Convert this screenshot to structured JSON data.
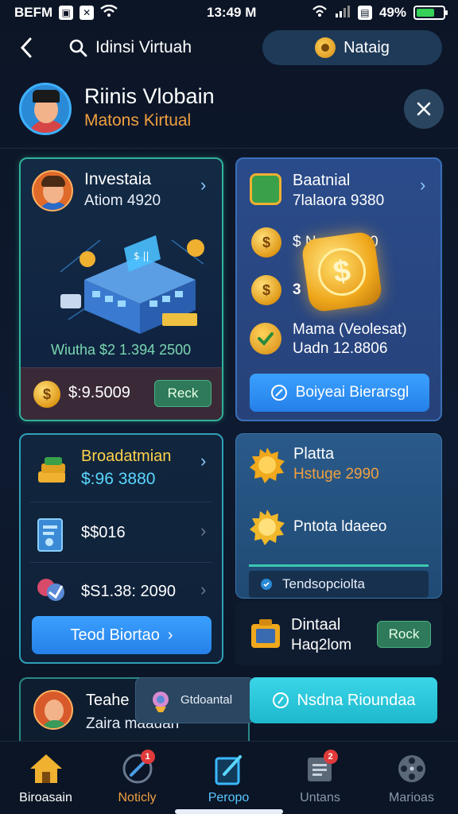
{
  "status_bar": {
    "carrier": "BEFM",
    "time": "13:49",
    "time_suffix": "M",
    "battery": "49%"
  },
  "top_nav": {
    "search_text": "Idinsi Virtuah",
    "network_label": "Nataig"
  },
  "profile": {
    "name": "Riinis Vlobain",
    "subtitle": "Matons Kirtual"
  },
  "invest_card": {
    "title": "Investaia",
    "subtitle": "Atiom 4920",
    "stats": "Wiutha $2 1.394 2500",
    "amount": "$:9.5009",
    "action": "Reck"
  },
  "balance_card": {
    "title": "Baatnial",
    "subtitle": "7lalaora 9380",
    "row1": "$ Nasa 2000",
    "row2": "3",
    "row3_title": "Mama (Veolesat)",
    "row3_sub": "Uadn 12.8806",
    "button": "Boiyeai Bierarsgl"
  },
  "broad_card": {
    "title": "Broadatmian",
    "amount": "$:96 3880",
    "row2": "$$016",
    "row3": "$S1.38: 2090",
    "button": "Teod Biortao"
  },
  "platform_card": {
    "title": "Platta",
    "subtitle": "Hstuge 2990",
    "row2": "Pntota ldaeeo",
    "footer": "Tendsopciolta"
  },
  "digital_card": {
    "title": "Dintaal",
    "subtitle": "Haq2lom",
    "action": "Rock"
  },
  "teach_card": {
    "title": "Teahe",
    "subtitle": "Zaira maauan",
    "chip": "Gtdoantal",
    "button": "Nsdna Rioundaa"
  },
  "bottom_nav": [
    {
      "label": "Biroasain",
      "color": "#ffffff"
    },
    {
      "label": "Noticly",
      "color": "#f0a040",
      "badge": "1"
    },
    {
      "label": "Peropo",
      "color": "#5ac8ff"
    },
    {
      "label": "Untans",
      "color": "#8a98ac",
      "badge": "2"
    },
    {
      "label": "Marioas",
      "color": "#8a98ac"
    }
  ],
  "colors": {
    "accent_orange": "#f0a040",
    "accent_blue": "#3aa0ff",
    "accent_teal": "#2fb39a",
    "gold": "#f0a81c"
  }
}
